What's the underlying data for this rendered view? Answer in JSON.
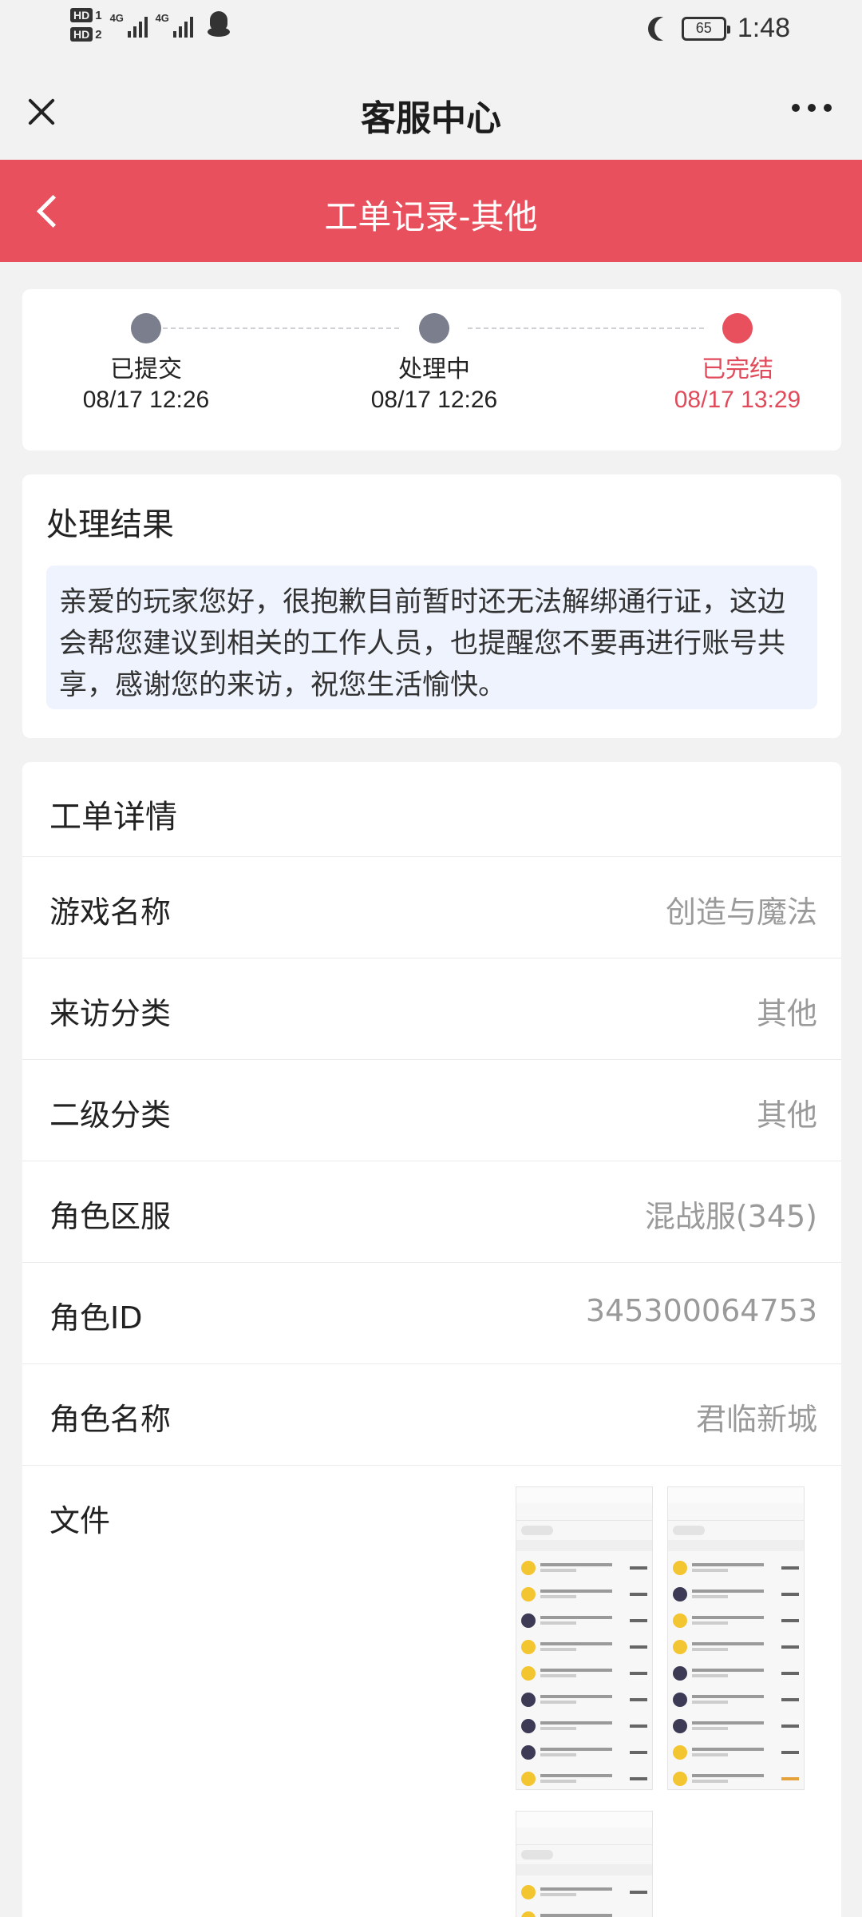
{
  "status_bar": {
    "sim1": "HD",
    "sim1_num": "1",
    "sim2": "HD",
    "sim2_num": "2",
    "net1": "4G",
    "net2": "4G",
    "battery": "65",
    "time": "1:48"
  },
  "app": {
    "title": "客服中心"
  },
  "header": {
    "title": "工单记录-其他"
  },
  "progress": {
    "steps": [
      {
        "label": "已提交",
        "time": "08/17 12:26",
        "active": false
      },
      {
        "label": "处理中",
        "time": "08/17 12:26",
        "active": false
      },
      {
        "label": "已完结",
        "time": "08/17 13:29",
        "active": true
      }
    ]
  },
  "result": {
    "title": "处理结果",
    "text": "亲爱的玩家您好，很抱歉目前暂时还无法解绑通行证，这边会帮您建议到相关的工作人员，也提醒您不要再进行账号共享，感谢您的来访，祝您生活愉快。"
  },
  "details": {
    "title": "工单详情",
    "rows": [
      {
        "label": "游戏名称",
        "value": "创造与魔法"
      },
      {
        "label": "来访分类",
        "value": "其他"
      },
      {
        "label": "二级分类",
        "value": "其他"
      },
      {
        "label": "角色区服",
        "value": "混战服(345)"
      },
      {
        "label": "角色ID",
        "value": "345300064753"
      },
      {
        "label": "角色名称",
        "value": "君临新城"
      }
    ],
    "files_label": "文件"
  },
  "colors": {
    "accent": "#e8505e",
    "step_dot": "#7b7e8c",
    "result_bg": "#eef3fd"
  }
}
